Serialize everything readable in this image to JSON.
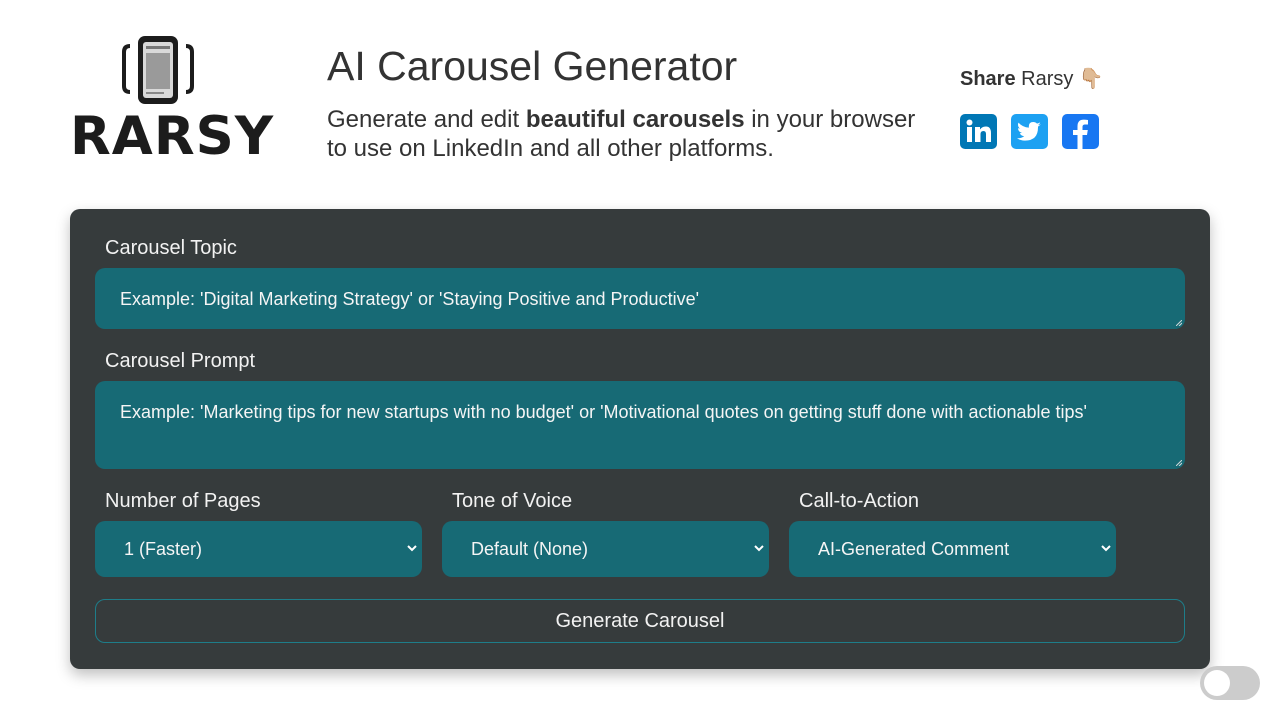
{
  "logo": {
    "text": "RARSY"
  },
  "header": {
    "title": "AI Carousel Generator",
    "subtitle_before": "Generate and edit ",
    "subtitle_bold": "beautiful carousels",
    "subtitle_after": " in your browser to use on LinkedIn and all other platforms."
  },
  "share": {
    "label_bold": "Share",
    "label_rest": " Rarsy 👇🏼",
    "icons": [
      "linkedin-icon",
      "twitter-icon",
      "facebook-icon"
    ]
  },
  "form": {
    "topic": {
      "label": "Carousel Topic",
      "placeholder": "Example: 'Digital Marketing Strategy' or 'Staying Positive and Productive'"
    },
    "prompt": {
      "label": "Carousel Prompt",
      "placeholder": "Example: 'Marketing tips for new startups with no budget' or 'Motivational quotes on getting stuff done with actionable tips'"
    },
    "pages": {
      "label": "Number of Pages",
      "value": "1 (Faster)"
    },
    "tone": {
      "label": "Tone of Voice",
      "value": "Default (None)"
    },
    "cta": {
      "label": "Call-to-Action",
      "value": "AI-Generated Comment"
    },
    "generate_label": "Generate Carousel"
  },
  "colors": {
    "panel": "#363b3c",
    "field": "#176a75",
    "accent_border": "#1e7d89",
    "linkedin": "#0077b5",
    "twitter": "#1da1f2",
    "facebook": "#1877f2"
  },
  "theme_toggle": {
    "on": false
  }
}
